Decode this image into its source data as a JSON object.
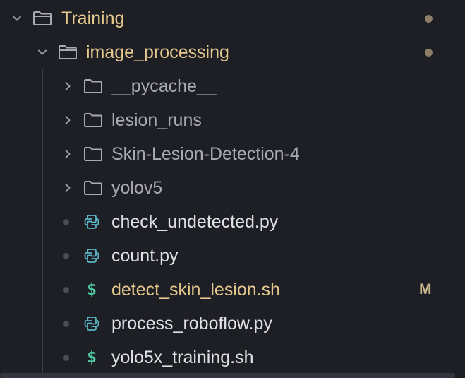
{
  "colors": {
    "folder_open_label": "#e6c98e",
    "folder_closed_label": "#a9abb1",
    "file_label": "#dfe1e6",
    "modified_label": "#e6c98e",
    "modified_badge": "#c9b58a",
    "python_icon": "#5bb8c7",
    "shell_icon": "#4ec9a0"
  },
  "tree": {
    "root": {
      "label": "Training",
      "icon": "folder-icon",
      "expanded": true,
      "has_changes": true
    },
    "subfolder": {
      "label": "image_processing",
      "icon": "folder-icon",
      "expanded": true,
      "has_changes": true
    },
    "children": [
      {
        "label": "__pycache__",
        "type": "folder",
        "icon": "folder-icon"
      },
      {
        "label": "lesion_runs",
        "type": "folder",
        "icon": "folder-icon"
      },
      {
        "label": "Skin-Lesion-Detection-4",
        "type": "folder",
        "icon": "folder-icon"
      },
      {
        "label": "yolov5",
        "type": "folder",
        "icon": "folder-icon"
      },
      {
        "label": "check_undetected.py",
        "type": "file",
        "icon": "python-icon"
      },
      {
        "label": "count.py",
        "type": "file",
        "icon": "python-icon"
      },
      {
        "label": "detect_skin_lesion.sh",
        "type": "file",
        "icon": "shell-icon",
        "badge": "M",
        "dollar": "$"
      },
      {
        "label": "process_roboflow.py",
        "type": "file",
        "icon": "python-icon"
      },
      {
        "label": "yolo5x_training.sh",
        "type": "file",
        "icon": "shell-icon",
        "dollar": "$"
      }
    ]
  }
}
